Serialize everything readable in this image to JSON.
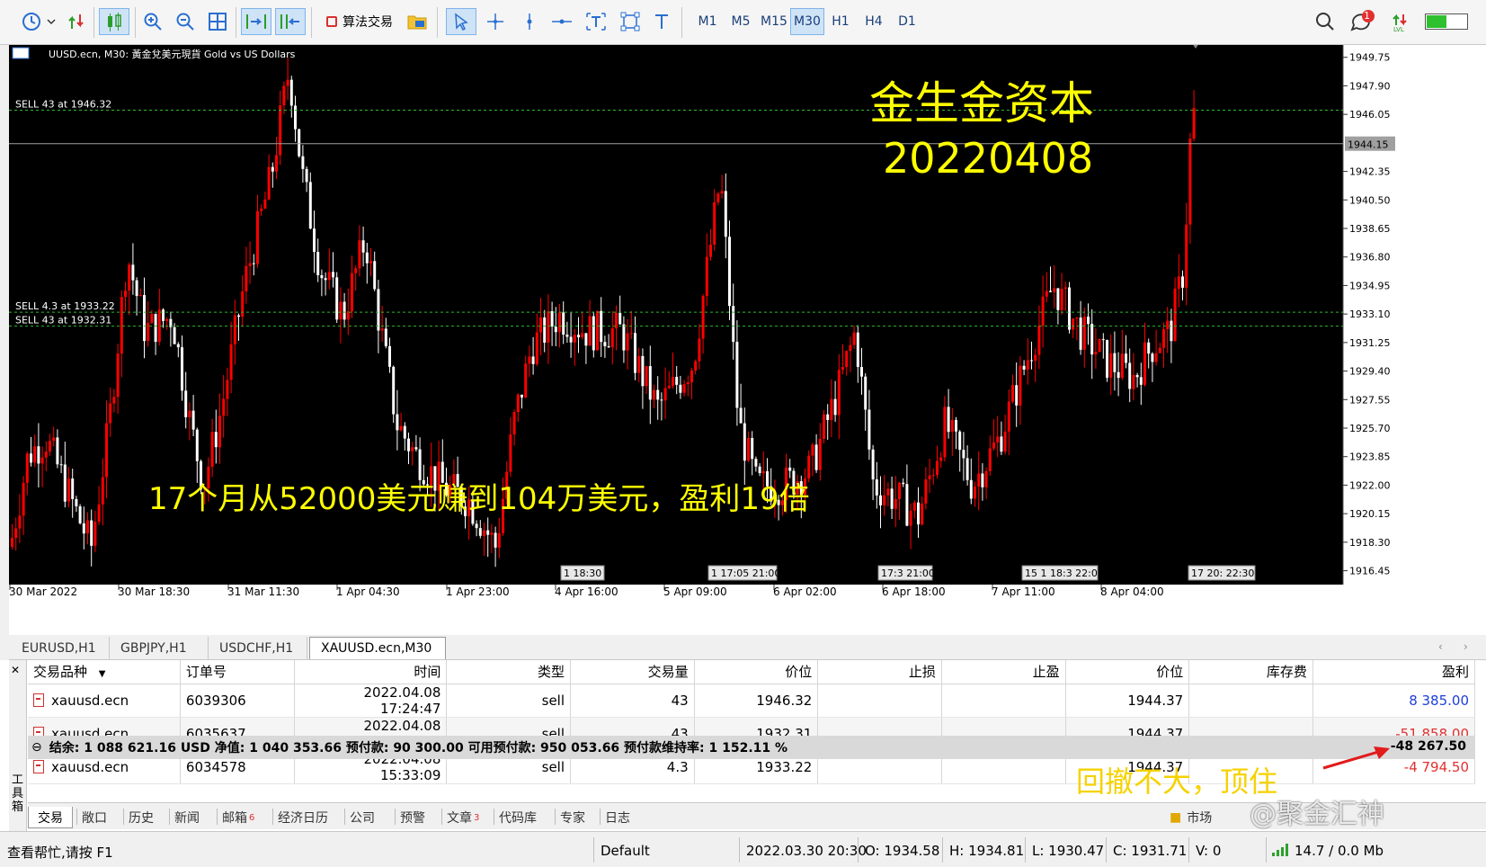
{
  "toolbar": {
    "algo_trading_label": "算法交易",
    "timeframes": [
      "M1",
      "M5",
      "M15",
      "M30",
      "H1",
      "H4",
      "D1"
    ],
    "active_timeframe": "M30",
    "notifications_count": "1"
  },
  "chart": {
    "header": "UUSD.ecn, M30:  黃金兌美元現貨  Gold vs US Dollars",
    "overlay_title_1": "金生金资本",
    "overlay_title_2": "20220408",
    "overlay_caption": "17个月从52000美元赚到104万美元，盈利19倍",
    "order_lines": [
      {
        "label": "SELL 43 at 1946.32",
        "price": 1946.32
      },
      {
        "label": "SELL 4.3 at 1933.22",
        "price": 1933.22
      },
      {
        "label": "SELL 43 at 1932.31",
        "price": 1932.31
      }
    ],
    "bid_line": 1944.15,
    "bid_label": "1944.15",
    "price_ticks": [
      "1949.75",
      "1947.90",
      "1946.05",
      "1944.15",
      "1942.35",
      "1940.50",
      "1938.65",
      "1936.80",
      "1934.95",
      "1933.10",
      "1931.25",
      "1929.40",
      "1927.55",
      "1925.70",
      "1923.85",
      "1922.00",
      "1920.15",
      "1918.30",
      "1916.45"
    ],
    "price_tick_values": [
      1949.75,
      1947.9,
      1946.05,
      1944.15,
      1942.35,
      1940.5,
      1938.65,
      1936.8,
      1934.95,
      1933.1,
      1931.25,
      1929.4,
      1927.55,
      1925.7,
      1923.85,
      1922.0,
      1920.15,
      1918.3,
      1916.45
    ],
    "time_ticks": [
      "30 Mar 2022",
      "30 Mar 18:30",
      "31 Mar 11:30",
      "1 Apr 04:30",
      "1 Apr 23:00",
      "4 Apr 16:00",
      "5 Apr 09:00",
      "6 Apr 02:00",
      "6 Apr 18:00",
      "7 Apr 11:00",
      "8 Apr 04:00"
    ],
    "event_labels": [
      "1 18:30",
      "1 17:05 21:00",
      "17:3 21:00",
      "15 1 18:3 22:00",
      "17 20: 22:30"
    ],
    "colors": {
      "background": "#000000",
      "bull": "#ff0000",
      "bear": "#ffffff",
      "order_line": "#2db82d",
      "overlay_text": "#ffff00"
    }
  },
  "symbol_tabs": [
    "EURUSD,H1",
    "GBPJPY,H1",
    "USDCHF,H1",
    "XAUUSD.ecn,M30"
  ],
  "active_symbol_tab": "XAUUSD.ecn,M30",
  "terminal": {
    "columns": [
      "交易品种",
      "订单号",
      "时间",
      "类型",
      "交易量",
      "价位",
      "止损",
      "止盈",
      "价位",
      "库存费",
      "盈利"
    ],
    "rows": [
      {
        "symbol": "xauusd.ecn",
        "ticket": "6039306",
        "time": "2022.04.08 17:24:47",
        "type": "sell",
        "volume": "43",
        "open_price": "1946.32",
        "sl": "",
        "tp": "",
        "price": "1944.37",
        "swap": "",
        "profit": "8 385.00",
        "profit_sign": "pos"
      },
      {
        "symbol": "xauusd.ecn",
        "ticket": "6035637",
        "time": "2022.04.08 16:00:13",
        "type": "sell",
        "volume": "43",
        "open_price": "1932.31",
        "sl": "",
        "tp": "",
        "price": "1944.37",
        "swap": "",
        "profit": "-51 858.00",
        "profit_sign": "neg"
      },
      {
        "symbol": "xauusd.ecn",
        "ticket": "6034578",
        "time": "2022.04.08 15:33:09",
        "type": "sell",
        "volume": "4.3",
        "open_price": "1933.22",
        "sl": "",
        "tp": "",
        "price": "1944.37",
        "swap": "",
        "profit": "-4 794.50",
        "profit_sign": "neg"
      }
    ],
    "summary": "结余: 1 088 621.16 USD  净值: 1 040 353.66  预付款: 90 300.00  可用预付款: 950 053.66  预付款维持率: 1 152.11 %",
    "total_profit": "-48 267.50",
    "note": "回撤不大，顶住",
    "side_label": "工具箱",
    "bottom_tabs": [
      {
        "label": "交易",
        "badge": ""
      },
      {
        "label": "敞口",
        "badge": ""
      },
      {
        "label": "历史",
        "badge": ""
      },
      {
        "label": "新闻",
        "badge": ""
      },
      {
        "label": "邮箱",
        "badge": "6"
      },
      {
        "label": "经济日历",
        "badge": ""
      },
      {
        "label": "公司",
        "badge": ""
      },
      {
        "label": "预警",
        "badge": ""
      },
      {
        "label": "文章",
        "badge": "3"
      },
      {
        "label": "代码库",
        "badge": ""
      },
      {
        "label": "专家",
        "badge": ""
      },
      {
        "label": "日志",
        "badge": ""
      }
    ],
    "market_label": "市场"
  },
  "statusbar": {
    "help": "查看帮忙,请按 F1",
    "profile": "Default",
    "datetime": "2022.03.30 20:30",
    "open": "O: 1934.58",
    "high": "H: 1934.81",
    "low": "L: 1930.47",
    "close": "C: 1931.71",
    "volume": "V: 0",
    "traffic": "14.7 / 0.0 Mb"
  },
  "watermark": "@聚金汇神"
}
